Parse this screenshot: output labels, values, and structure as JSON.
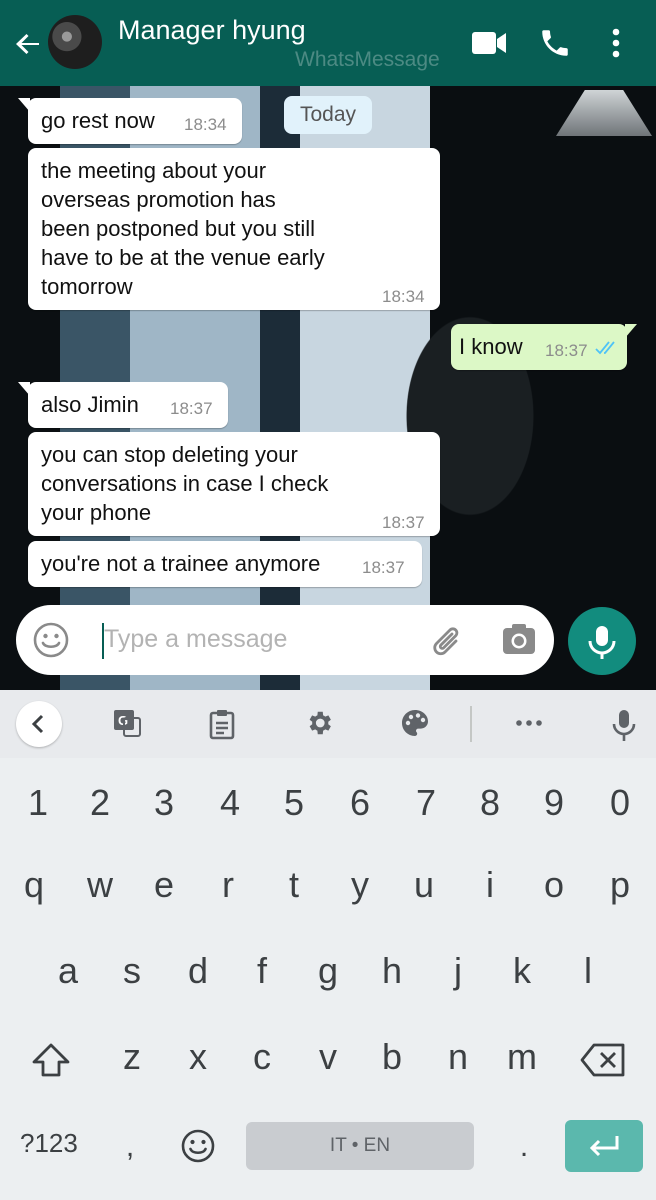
{
  "header": {
    "contact_name": "Manager hyung",
    "watermark": "WhatsMessage",
    "colors": {
      "bar": "#075e54",
      "accent": "#128c7e"
    },
    "icons": [
      "back-arrow-icon",
      "video-call-icon",
      "phone-call-icon",
      "more-options-icon"
    ]
  },
  "chat": {
    "date_chip": "Today",
    "messages": [
      {
        "dir": "in",
        "text": "go rest now",
        "time": "18:34"
      },
      {
        "dir": "in",
        "lines": [
          "the meeting about your",
          "overseas promotion has",
          "been postponed but you still",
          "have to be at the venue early",
          "tomorrow"
        ],
        "time": "18:34"
      },
      {
        "dir": "out",
        "text": "I know",
        "time": "18:37",
        "status": "read-double-check"
      },
      {
        "dir": "in",
        "text": "also Jimin",
        "time": "18:37"
      },
      {
        "dir": "in",
        "lines": [
          "you can stop deleting your",
          "conversations in case I check",
          "your phone"
        ],
        "time": "18:37"
      },
      {
        "dir": "in",
        "text": "you're not a trainee anymore",
        "time": "18:37"
      }
    ]
  },
  "composer": {
    "placeholder": "Type a message",
    "icons": [
      "emoji-icon",
      "attach-icon",
      "camera-icon",
      "mic-icon"
    ]
  },
  "keyboard": {
    "toolbar_icons": [
      "collapse-chevron-icon",
      "translate-icon",
      "clipboard-icon",
      "settings-icon",
      "theme-palette-icon",
      "more-icon",
      "voice-mic-icon"
    ],
    "number_row": [
      "1",
      "2",
      "3",
      "4",
      "5",
      "6",
      "7",
      "8",
      "9",
      "0"
    ],
    "row1": [
      "q",
      "w",
      "e",
      "r",
      "t",
      "y",
      "u",
      "i",
      "o",
      "p"
    ],
    "row2": [
      "a",
      "s",
      "d",
      "f",
      "g",
      "h",
      "j",
      "k",
      "l"
    ],
    "row3": [
      "z",
      "x",
      "c",
      "v",
      "b",
      "n",
      "m"
    ],
    "symbols_key": "?123",
    "comma": ",",
    "period": ".",
    "space_label": "IT • EN"
  }
}
